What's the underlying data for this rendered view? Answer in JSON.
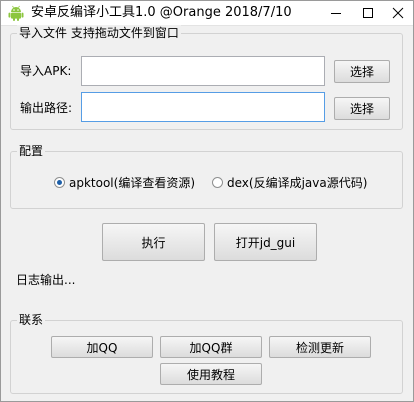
{
  "window": {
    "title": "安卓反编译小工具1.0 @Orange 2018/7/10",
    "icon": "android-icon",
    "controls": [
      "minimize-icon",
      "maximize-icon",
      "close-icon"
    ]
  },
  "import_group": {
    "label": "导入文件  支持拖动文件到窗口",
    "apk_label": "导入APK:",
    "apk_value": "",
    "output_label": "输出路径:",
    "output_value": "",
    "browse_label": "选择",
    "browse2_label": "选择"
  },
  "config_group": {
    "label": "配置",
    "options": [
      {
        "label": "apktool(编译查看资源)",
        "selected": true
      },
      {
        "label": "dex(反编译成java源代码)",
        "selected": false
      }
    ]
  },
  "actions": {
    "run_label": "执行",
    "open_jdgui_label": "打开jd_gui"
  },
  "log": {
    "text": "日志输出..."
  },
  "contact_group": {
    "label": "联系",
    "add_qq_label": "加QQ",
    "add_qq_group_label": "加QQ群",
    "check_update_label": "检测更新",
    "tutorial_label": "使用教程"
  },
  "colors": {
    "window_bg": "#f0f0f0",
    "android_green": "#8cc63f",
    "focus_border": "#569de5"
  }
}
